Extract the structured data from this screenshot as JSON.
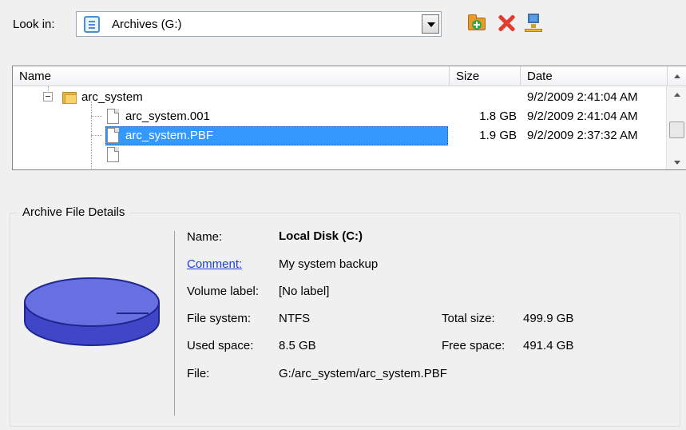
{
  "look_in": {
    "label": "Look in:",
    "value": "Archives (G:)",
    "icon": "drive-icon"
  },
  "toolbar": {
    "buttons": [
      "new-folder-icon",
      "delete-icon",
      "network-icon"
    ]
  },
  "file_list": {
    "columns": {
      "name": "Name",
      "size": "Size",
      "date": "Date"
    },
    "rows": [
      {
        "name": "arc_system",
        "size": "",
        "date": "9/2/2009 2:41:04 AM",
        "type": "folder"
      },
      {
        "name": "arc_system.001",
        "size": "1.8 GB",
        "date": "9/2/2009 2:41:04 AM",
        "type": "file"
      },
      {
        "name": "arc_system.PBF",
        "size": "1.9 GB",
        "date": "9/2/2009 2:37:32 AM",
        "type": "file",
        "selected": true
      }
    ]
  },
  "details": {
    "group_title": "Archive File Details",
    "name_label": "Name:",
    "name_value": "Local Disk (C:)",
    "comment_label": "Comment:",
    "comment_value": "My system backup",
    "volume_label_label": "Volume label:",
    "volume_label_value": "[No label]",
    "file_system_label": "File system:",
    "file_system_value": "NTFS",
    "total_size_label": "Total size:",
    "total_size_value": "499.9 GB",
    "used_space_label": "Used space:",
    "used_space_value": "8.5 GB",
    "free_space_label": "Free space:",
    "free_space_value": "491.4 GB",
    "file_label": "File:",
    "file_value": "G:/arc_system/arc_system.PBF"
  },
  "colors": {
    "selection": "#3399ff",
    "disk_fill": "#6670e0",
    "link": "#1a3fd8"
  }
}
